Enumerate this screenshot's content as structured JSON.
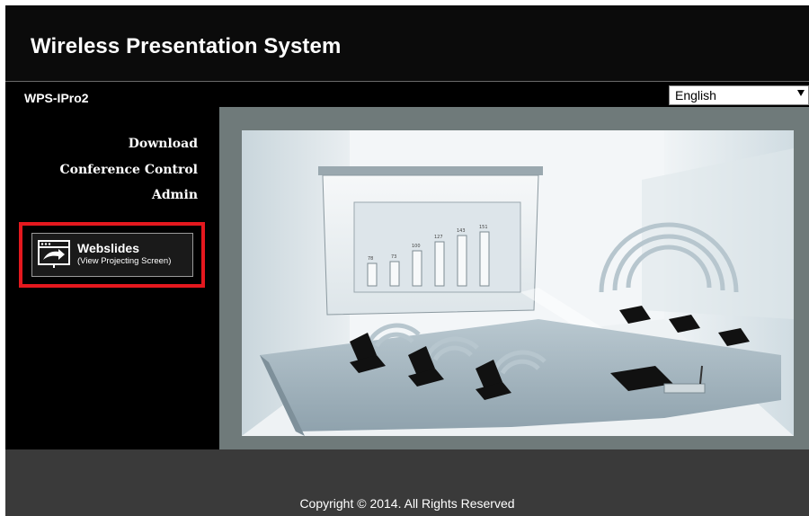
{
  "header": {
    "title": "Wireless Presentation System"
  },
  "device": {
    "name": "WPS-IPro2"
  },
  "language": {
    "selected": "English"
  },
  "nav": {
    "items": [
      {
        "label": "Download"
      },
      {
        "label": "Conference Control"
      },
      {
        "label": "Admin"
      }
    ]
  },
  "webslides": {
    "title": "Webslides",
    "subtitle": "(View Projecting Screen)",
    "icon": "presentation-screen-icon"
  },
  "illustration": {
    "bar_labels": [
      "78",
      "73",
      "100",
      "127",
      "143",
      "151"
    ]
  },
  "footer": {
    "copyright": "Copyright © 2014. All Rights Reserved"
  },
  "colors": {
    "highlight": "#e4181e",
    "content_bg": "#6f7a7a",
    "footer_bg": "#3a3a3a"
  }
}
